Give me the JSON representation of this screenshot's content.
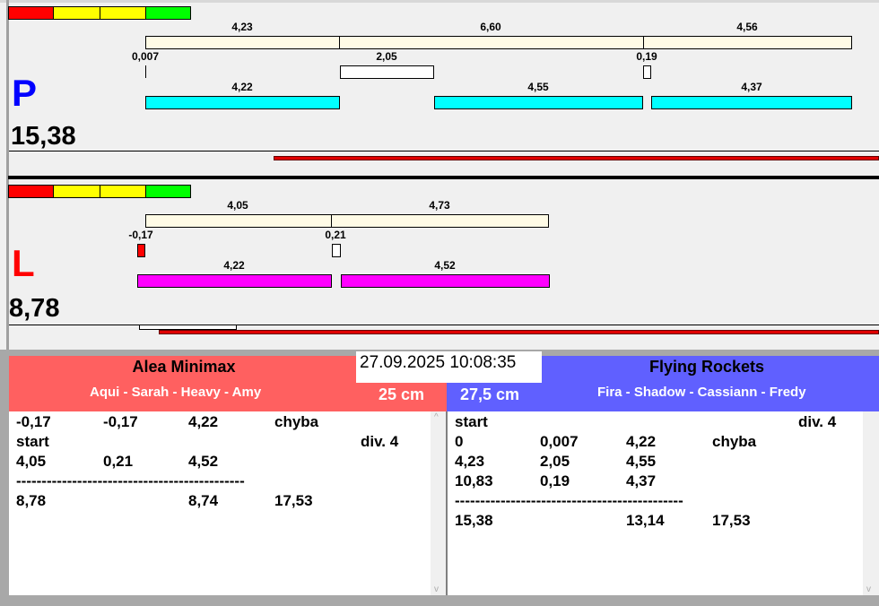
{
  "p_panel": {
    "letter": "P",
    "total": "15,38",
    "row1": [
      "4,23",
      "6,60",
      "4,56"
    ],
    "row2": [
      "0,007",
      "2,05",
      "0,19"
    ],
    "row3": [
      "4,22",
      "4,55",
      "4,37"
    ]
  },
  "l_panel": {
    "letter": "L",
    "total": "8,78",
    "row1": [
      "4,05",
      "4,73"
    ],
    "row2": [
      "-0,17",
      "0,21"
    ],
    "row3": [
      "4,22",
      "4,52"
    ]
  },
  "datetime": "27.09.2025 10:08:35",
  "left_team": {
    "name": "Alea Minimax",
    "players": "Aqui - Sarah - Heavy - Amy",
    "distance": "25 cm",
    "color": "#ff6060",
    "rows": [
      [
        "-0,17",
        "-0,17",
        "4,22",
        "chyba",
        ""
      ],
      [
        "start",
        "",
        "",
        "",
        "div.  4"
      ],
      [
        "4,05",
        "0,21",
        "4,52",
        "",
        ""
      ],
      [
        "---------------------------------------------",
        "",
        "",
        "",
        ""
      ],
      [
        "8,78",
        "",
        "8,74",
        "17,53",
        ""
      ]
    ]
  },
  "right_team": {
    "name": "Flying Rockets",
    "players": "Fira - Shadow - Cassiann - Fredy",
    "distance": "27,5 cm",
    "color": "#6060ff",
    "rows": [
      [
        "start",
        "",
        "",
        "",
        "div.  4"
      ],
      [
        "0",
        "0,007",
        "4,22",
        "chyba",
        ""
      ],
      [
        "4,23",
        "2,05",
        "4,55",
        "",
        ""
      ],
      [
        "10,83",
        "0,19",
        "4,37",
        "",
        ""
      ],
      [
        "---------------------------------------------",
        "",
        "",
        "",
        ""
      ],
      [
        "15,38",
        "",
        "13,14",
        "17,53",
        ""
      ]
    ]
  }
}
